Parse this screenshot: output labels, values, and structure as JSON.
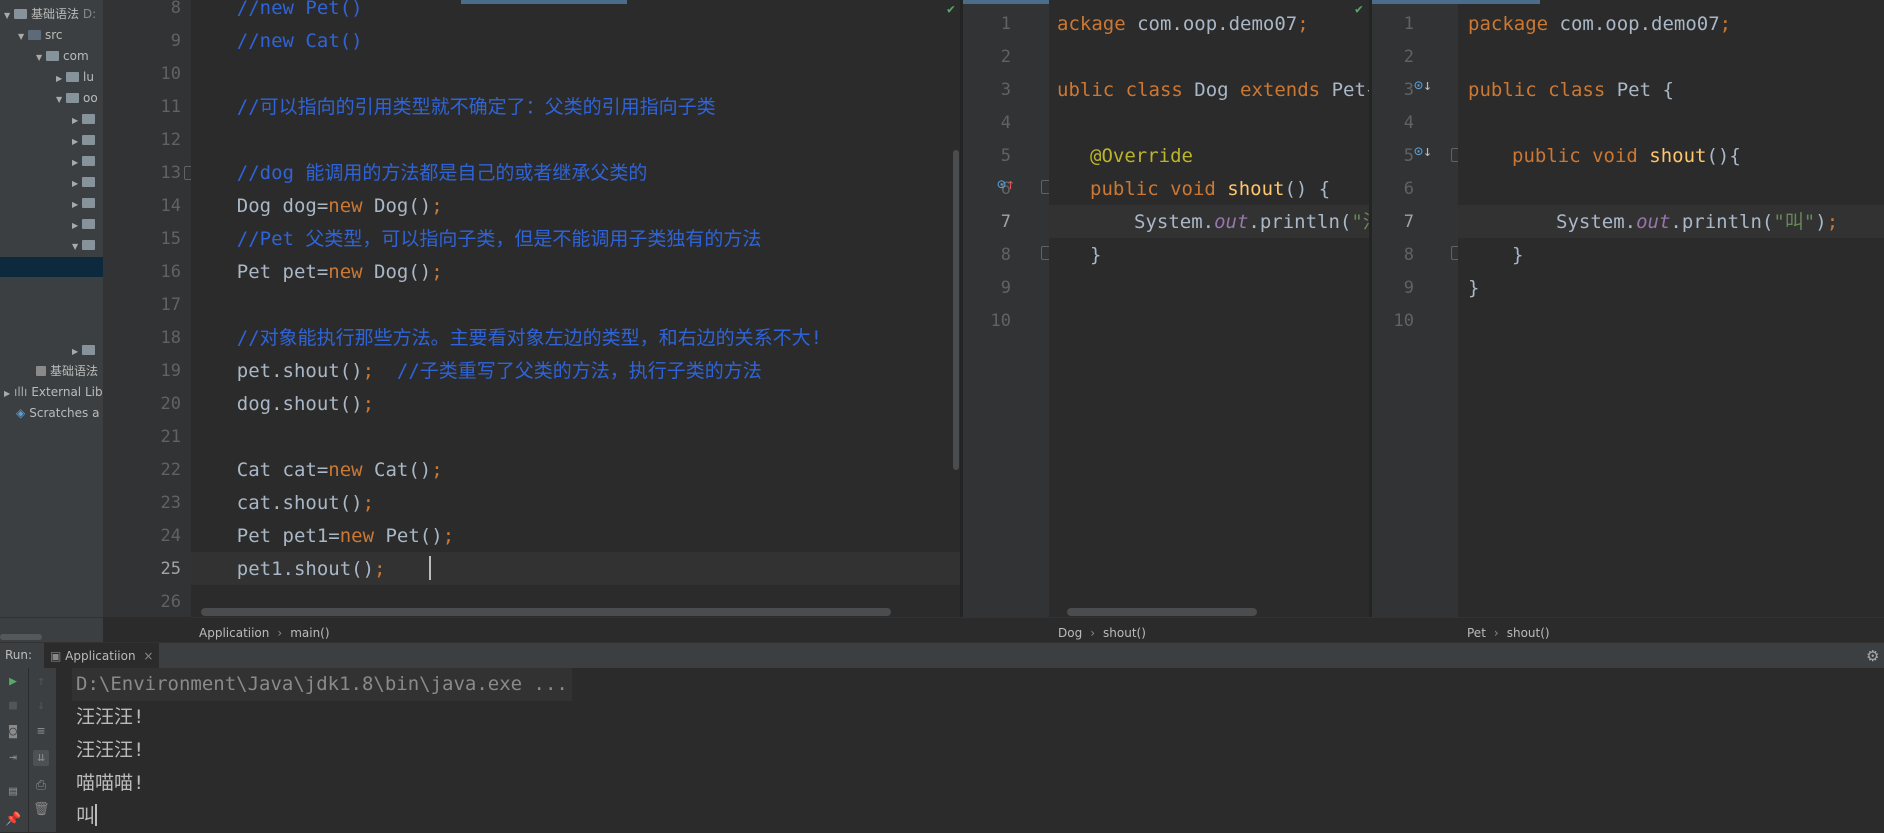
{
  "tree": {
    "items": [
      {
        "label": "基础语法",
        "suffix": "D:",
        "indent": 0
      },
      {
        "label": "src",
        "indent": 1
      },
      {
        "label": "com",
        "indent": 2
      },
      {
        "label": "lu",
        "indent": 3
      },
      {
        "label": "oo",
        "indent": 3
      },
      {
        "label": "基础语法",
        "indent": 2
      },
      {
        "label": "External Lib",
        "indent": 0
      },
      {
        "label": "Scratches a",
        "indent": 0
      }
    ]
  },
  "editor_main": {
    "lines": [
      {
        "num": "8",
        "text": "    //new Pet()"
      },
      {
        "num": "9",
        "text": "    //new Cat()"
      },
      {
        "num": "10",
        "text": ""
      },
      {
        "num": "11",
        "text": "    //可以指向的引用类型就不确定了：父类的引用指向子类"
      },
      {
        "num": "12",
        "text": ""
      },
      {
        "num": "13",
        "text": "    //dog 能调用的方法都是自己的或者继承父类的"
      },
      {
        "num": "14",
        "a": "    Dog dog=",
        "kw": "new",
        "b": " Dog()",
        "semi": ";"
      },
      {
        "num": "15",
        "text": "    //Pet 父类型，可以指向子类，但是不能调用子类独有的方法"
      },
      {
        "num": "16",
        "a": "    Pet pet=",
        "kw": "new",
        "b": " Dog()",
        "semi": ";"
      },
      {
        "num": "17",
        "text": ""
      },
      {
        "num": "18",
        "text": "    //对象能执行那些方法。主要看对象左边的类型，和右边的关系不大!"
      },
      {
        "num": "19",
        "a": "    pet.shout()",
        "semi": ";",
        "comment": "  //子类重写了父类的方法，执行子类的方法"
      },
      {
        "num": "20",
        "a": "    dog.shout()",
        "semi": ";"
      },
      {
        "num": "21",
        "text": ""
      },
      {
        "num": "22",
        "a": "    Cat cat=",
        "kw": "new",
        "b": " Cat()",
        "semi": ";"
      },
      {
        "num": "23",
        "a": "    cat.shout()",
        "semi": ";"
      },
      {
        "num": "24",
        "a": "    Pet pet1=",
        "kw": "new",
        "b": " Pet()",
        "semi": ";"
      },
      {
        "num": "25",
        "a": "    pet1.shout()",
        "semi": ";"
      },
      {
        "num": "26",
        "text": ""
      }
    ],
    "breadcrumb": [
      "Applicatiion",
      "main()"
    ]
  },
  "editor_dog": {
    "line_numbers": [
      "1",
      "2",
      "3",
      "4",
      "5",
      "6",
      "7",
      "8",
      "9",
      "10"
    ],
    "l1_kw": "ackage",
    "l1_rest": " com.oop.demo07",
    "l1_semi": ";",
    "l3_kw": "ublic class",
    "l3_name": " Dog ",
    "l3_kw2": "extends",
    "l3_rest": " Pet{",
    "l5": "@Override",
    "l6_kw": "public void",
    "l6_fn": " shout",
    "l6_rest": "() {",
    "l7_a": "System.",
    "l7_it": "out",
    "l7_b": ".println(",
    "l7_str": "\"汪",
    "l8": "}",
    "breadcrumb": [
      "Dog",
      "shout()"
    ]
  },
  "editor_pet": {
    "line_numbers": [
      "1",
      "2",
      "3",
      "4",
      "5",
      "6",
      "7",
      "8",
      "9",
      "10"
    ],
    "l1_kw": "package",
    "l1_rest": " com.oop.demo07",
    "l1_semi": ";",
    "l3_kw": "public class",
    "l3_rest": " Pet {",
    "l5_kw": "public void",
    "l5_fn": " shout",
    "l5_rest": "(){",
    "l7_a": "System.",
    "l7_it": "out",
    "l7_b": ".println(",
    "l7_str": "\"叫\"",
    "l7_c": ")",
    "l7_semi": ";",
    "l8": "}",
    "l9": "}",
    "breadcrumb": [
      "Pet",
      "shout()"
    ]
  },
  "run": {
    "label": "Run:",
    "tab": "Applicatiion",
    "command": "D:\\Environment\\Java\\jdk1.8\\bin\\java.exe ...",
    "output": [
      "汪汪汪!",
      "汪汪汪!",
      "喵喵喵!",
      "叫"
    ]
  },
  "colors": {
    "keyword": "#cc7832",
    "comment": "#2f64d8",
    "string": "#6a8759",
    "static_field": "#9876aa",
    "annotation": "#bbb529",
    "method": "#ffc66d"
  }
}
